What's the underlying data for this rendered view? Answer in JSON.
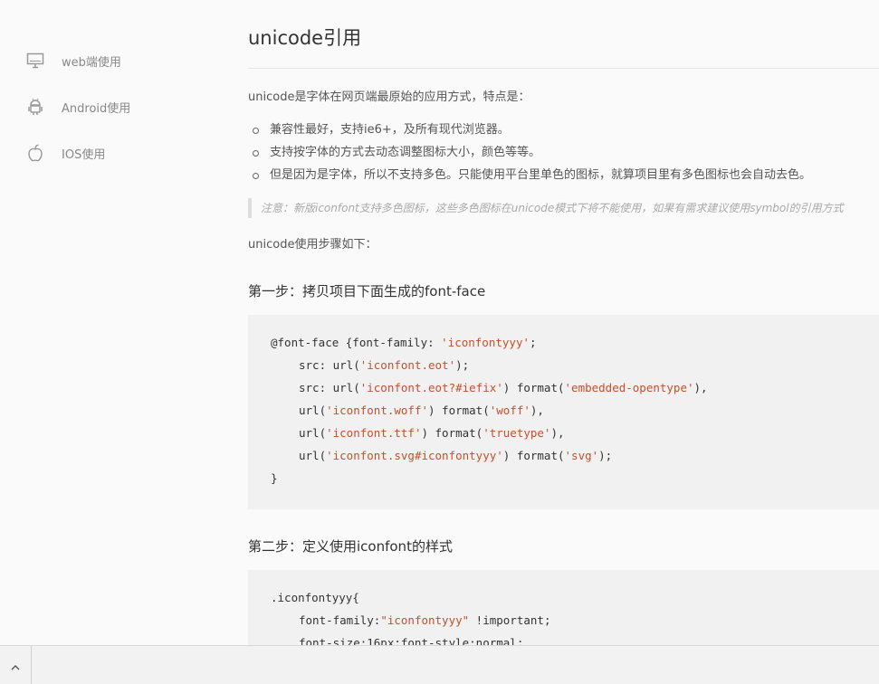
{
  "sidebar": {
    "items": [
      {
        "label": "web端使用",
        "icon": "monitor-icon"
      },
      {
        "label": "Android使用",
        "icon": "android-icon"
      },
      {
        "label": "IOS使用",
        "icon": "apple-icon"
      }
    ]
  },
  "main": {
    "title": "unicode引用",
    "intro": "unicode是字体在网页端最原始的应用方式，特点是：",
    "bullets": [
      "兼容性最好，支持ie6+，及所有现代浏览器。",
      "支持按字体的方式去动态调整图标大小，颜色等等。",
      "但是因为是字体，所以不支持多色。只能使用平台里单色的图标，就算项目里有多色图标也会自动去色。"
    ],
    "note": "注意：新版iconfont支持多色图标，这些多色图标在unicode模式下将不能使用，如果有需求建议使用symbol的引用方式",
    "steps_intro": "unicode使用步骤如下：",
    "step1": {
      "heading": "第一步：拷贝项目下面生成的font-face",
      "code": {
        "l1_a": "@font-face {font-family: ",
        "l1_s": "'iconfontyyy'",
        "l1_b": ";",
        "l2_a": "src: url(",
        "l2_s": "'iconfont.eot'",
        "l2_b": ");",
        "l3_a": "src: url(",
        "l3_s1": "'iconfont.eot?#iefix'",
        "l3_b": ") format(",
        "l3_s2": "'embedded-opentype'",
        "l3_c": "),",
        "l4_a": "url(",
        "l4_s1": "'iconfont.woff'",
        "l4_b": ") format(",
        "l4_s2": "'woff'",
        "l4_c": "),",
        "l5_a": "url(",
        "l5_s1": "'iconfont.ttf'",
        "l5_b": ") format(",
        "l5_s2": "'truetype'",
        "l5_c": "),",
        "l6_a": "url(",
        "l6_s1": "'iconfont.svg#iconfontyyy'",
        "l6_b": ") format(",
        "l6_s2": "'svg'",
        "l6_c": ");",
        "l7": "}"
      }
    },
    "step2": {
      "heading": "第二步：定义使用iconfont的样式",
      "code": {
        "l1": ".iconfontyyy{",
        "l2_a": "font-family:",
        "l2_s": "\"iconfontyyy\"",
        "l2_b": " !important;",
        "l3": "font-size:16px;font-style:normal;"
      }
    }
  },
  "bottom_bar": {
    "toggle_icon": "chevron-up-icon"
  },
  "colors": {
    "code_string": "#c7502a",
    "code_bg": "#f1f1f1",
    "page_bg": "#fafafa"
  }
}
